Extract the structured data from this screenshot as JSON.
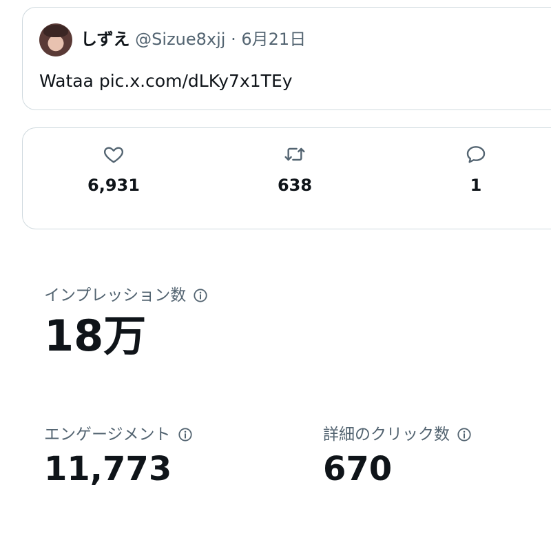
{
  "tweet": {
    "display_name": "しずえ",
    "handle": "@Sizue8xjj",
    "separator": "·",
    "date": "6月21日",
    "text": "Wataa pic.x.com/dLKy7x1TEy"
  },
  "engagement_bar": {
    "likes": "6,931",
    "retweets": "638",
    "replies": "1",
    "icons": [
      "heart-icon",
      "retweet-icon",
      "reply-icon"
    ]
  },
  "analytics": {
    "impressions_label": "インプレッション数",
    "impressions_value": "18万",
    "engagements_label": "エンゲージメント",
    "engagements_value": "11,773",
    "detail_clicks_label": "詳細のクリック数",
    "detail_clicks_value": "670"
  },
  "colors": {
    "text_primary": "#0f1419",
    "text_secondary": "#536471",
    "border": "#cfd9de"
  }
}
